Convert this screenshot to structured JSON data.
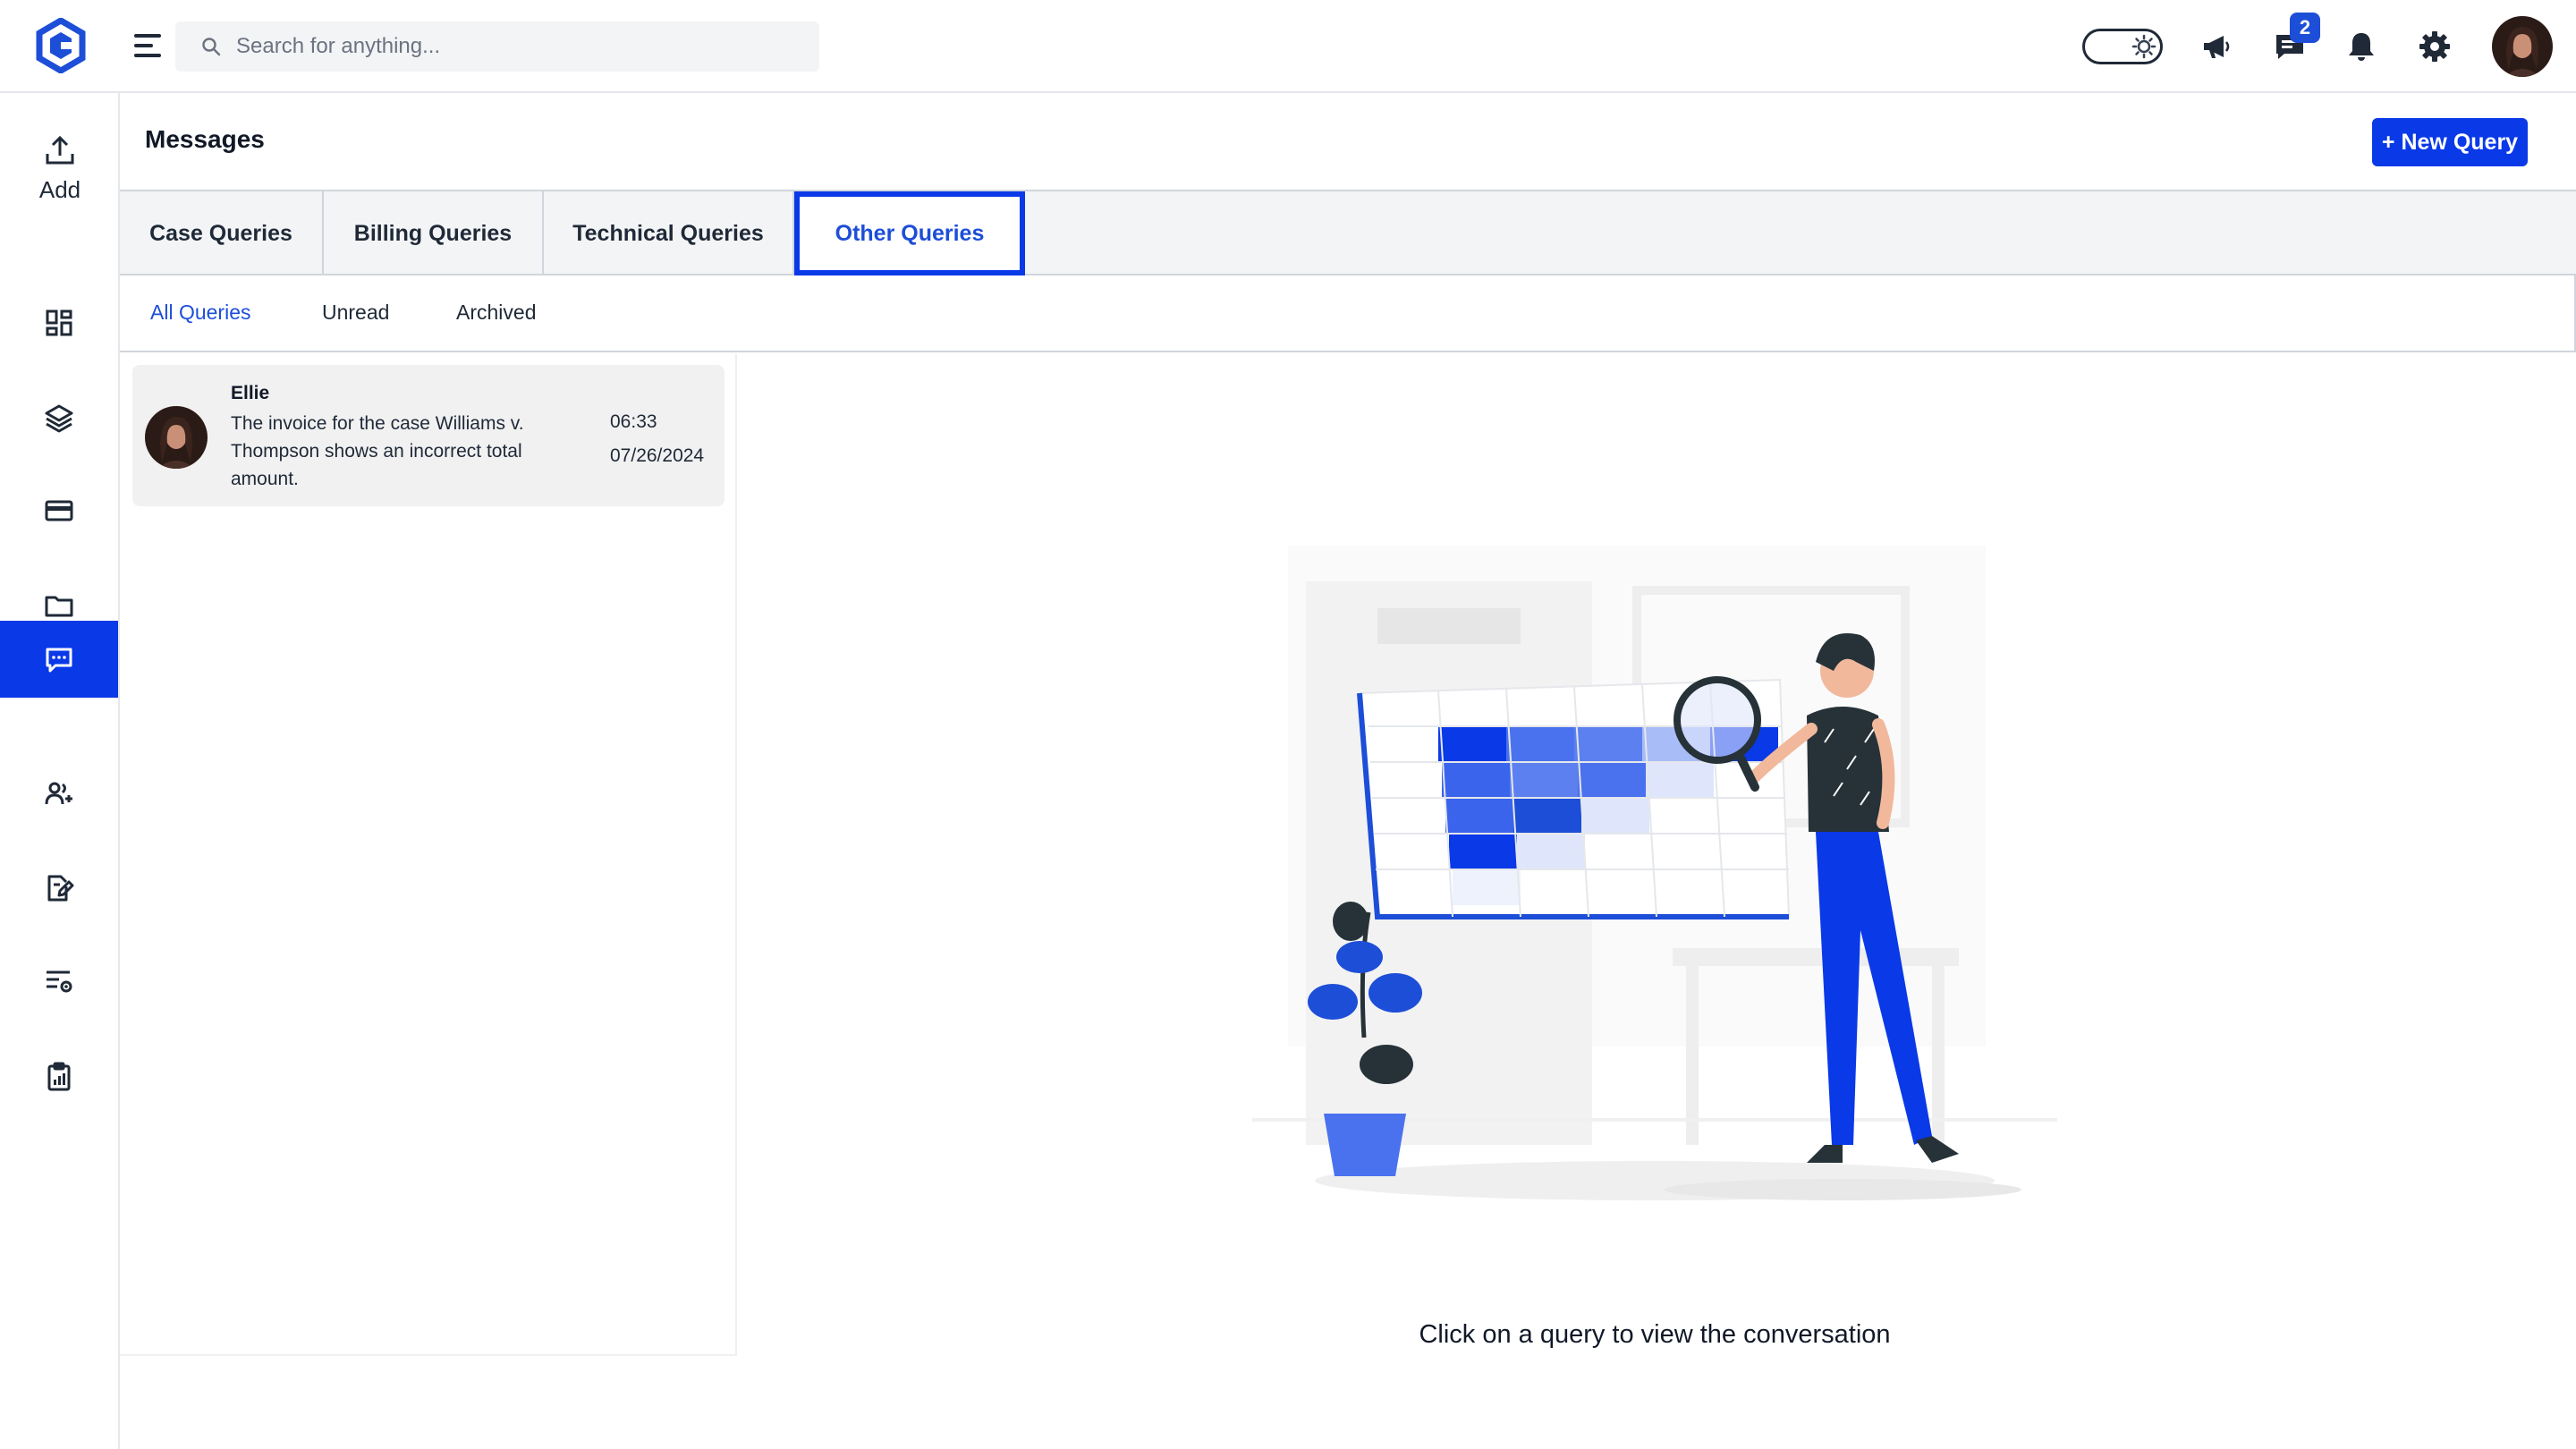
{
  "header": {
    "search_placeholder": "Search for anything...",
    "chat_badge": "2"
  },
  "sidebar": {
    "add_label": "Add"
  },
  "main": {
    "title": "Messages",
    "new_query_label": "+ New Query",
    "tabs": [
      {
        "label": "Case Queries"
      },
      {
        "label": "Billing Queries"
      },
      {
        "label": "Technical Queries"
      },
      {
        "label": "Other Queries"
      }
    ],
    "subtabs": [
      {
        "label": "All Queries"
      },
      {
        "label": "Unread"
      },
      {
        "label": "Archived"
      }
    ],
    "messages": [
      {
        "name": "Ellie",
        "text": "The invoice for the case Williams v. Thompson shows an incorrect total amount.",
        "time": "06:33",
        "date": "07/26/2024"
      }
    ],
    "empty_state": "Click on a query to view the conversation"
  },
  "colors": {
    "accent": "#0a39e8",
    "active_text": "#1d4ed8"
  }
}
